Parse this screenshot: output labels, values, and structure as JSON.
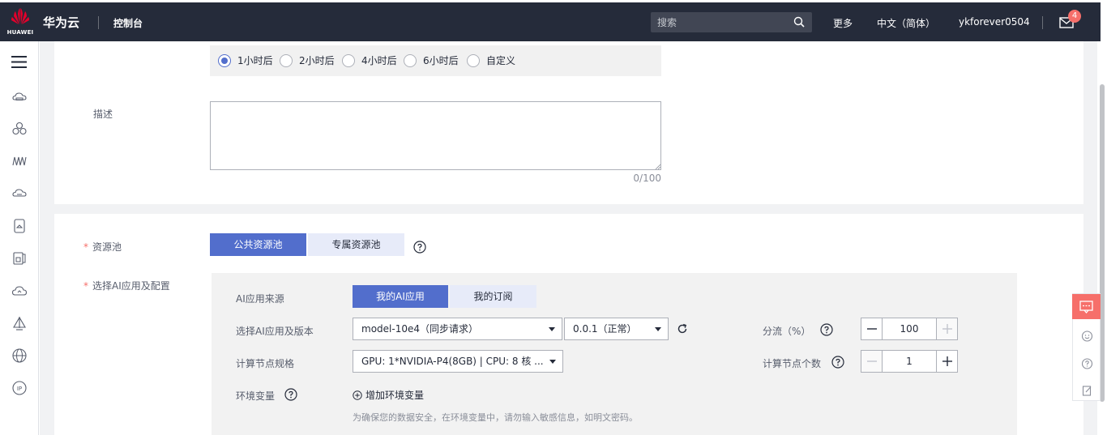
{
  "header": {
    "logo_text": "HUAWEI",
    "brand": "华为云",
    "console": "控制台",
    "search_placeholder": "搜索",
    "more": "更多",
    "language": "中文（简体）",
    "username": "ykforever0504",
    "mail_badge": "4"
  },
  "left_nav": {
    "icons": [
      "menu-icon",
      "cloud-server-icon",
      "cluster-icon",
      "network-icon",
      "database-icon",
      "storage-icon",
      "container-icon",
      "cloud-icon",
      "deploy-icon",
      "globe-icon",
      "ip-icon"
    ]
  },
  "timeout": {
    "options": [
      "1小时后",
      "2小时后",
      "4小时后",
      "6小时后",
      "自定义"
    ],
    "selected": "1小时后"
  },
  "description": {
    "label": "描述",
    "value": "",
    "counter": "0/100"
  },
  "resource_pool": {
    "label": "资源池",
    "options": [
      "公共资源池",
      "专属资源池"
    ],
    "selected": "公共资源池"
  },
  "ai_config": {
    "label": "选择AI应用及配置",
    "source_label": "AI应用来源",
    "source_options": [
      "我的AI应用",
      "我的订阅"
    ],
    "source_selected": "我的AI应用",
    "version_label": "选择AI应用及版本",
    "app_value": "model-10e4（同步请求）",
    "version_value": "0.0.1（正常）",
    "split_label": "分流（%）",
    "split_value": "100",
    "spec_label": "计算节点规格",
    "spec_value": "GPU: 1*NVIDIA-P4(8GB) | CPU: 8 核 ...",
    "node_count_label": "计算节点个数",
    "node_count_value": "1",
    "env_label": "环境变量",
    "add_env": "增加环境变量",
    "env_hint": "为确保您的数据安全，在环境变量中，请勿输入敏感信息，如明文密码。"
  },
  "colors": {
    "topbar": "#252b3a",
    "primary": "#526ecc",
    "secondary_button": "#e7ebf9",
    "required": "#f66f6a",
    "badge": "#f66f6a"
  }
}
